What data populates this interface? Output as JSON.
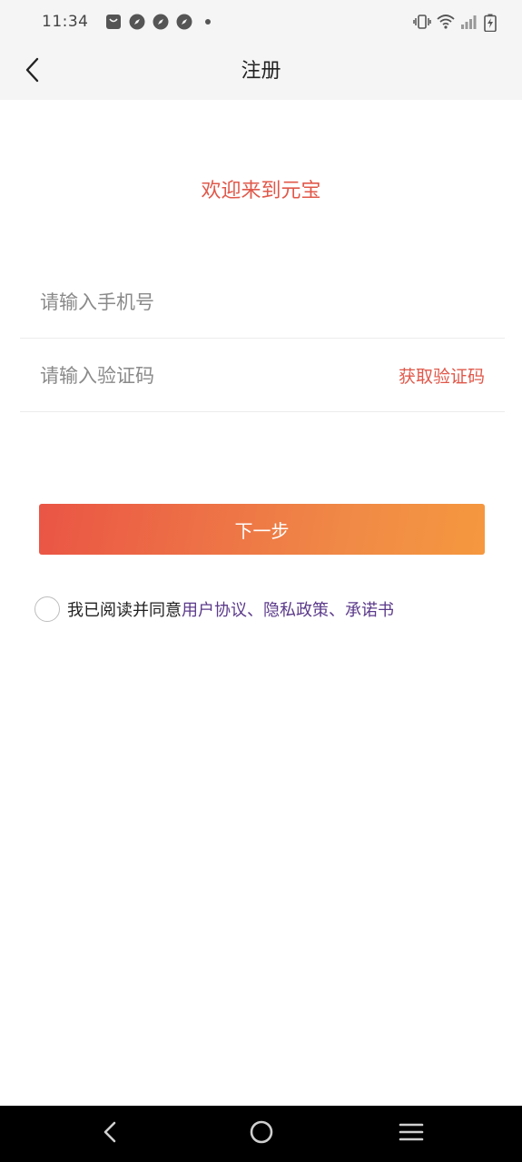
{
  "status_bar": {
    "time": "11:34",
    "icons_left": [
      "shopping-bag-icon",
      "compass-icon",
      "compass-icon",
      "compass-icon",
      "dot-icon"
    ],
    "icons_right": [
      "vibrate-icon",
      "wifi-icon",
      "signal-icon",
      "battery-charging-icon"
    ]
  },
  "app_bar": {
    "title": "注册",
    "back_icon": "chevron-left-icon"
  },
  "welcome_text": "欢迎来到元宝",
  "form": {
    "phone_placeholder": "请输入手机号",
    "code_placeholder": "请输入验证码",
    "get_code_label": "获取验证码",
    "next_label": "下一步"
  },
  "agreement": {
    "prefix": "我已阅读并同意",
    "user_agreement": "用户协议",
    "separator1": "、",
    "privacy_policy": "隐私政策",
    "separator2": "、",
    "commitment": "承诺书",
    "checked": false
  },
  "colors": {
    "accent": "#e0584a",
    "link": "#5b3a8a",
    "button_gradient_start": "#ea5545",
    "button_gradient_end": "#f5983f"
  },
  "nav_bar": {
    "icons": [
      "back-triangle-icon",
      "home-circle-icon",
      "menu-lines-icon"
    ]
  }
}
